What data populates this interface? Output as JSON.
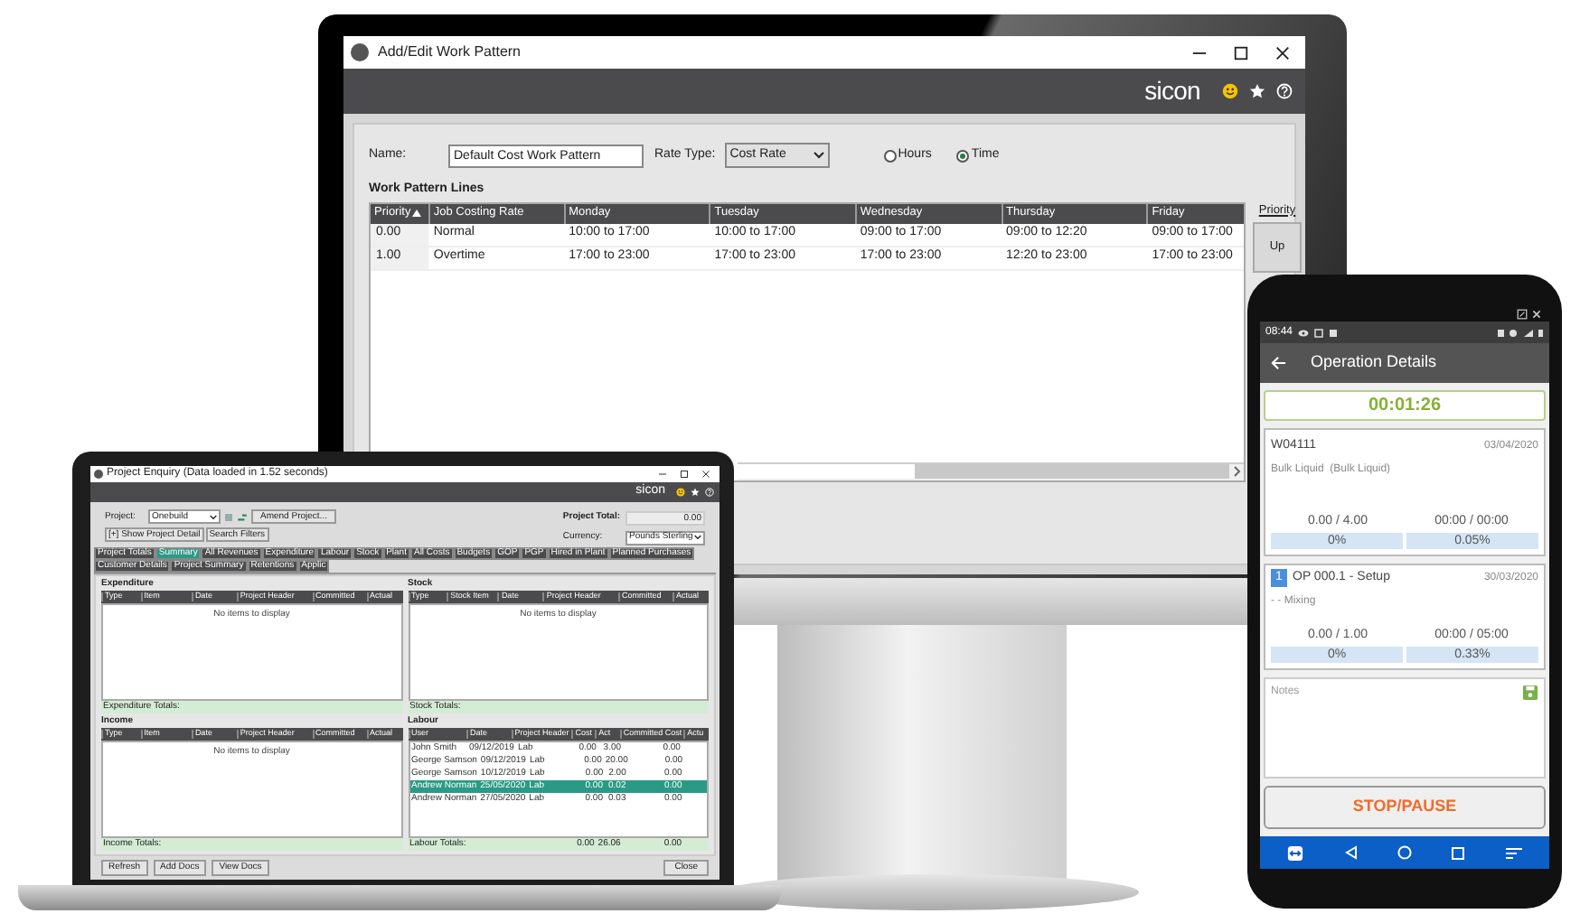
{
  "monitor": {
    "window_title": "Add/Edit Work Pattern",
    "brand": "sicon",
    "name_label": "Name:",
    "name_value": "Default Cost Work Pattern",
    "rate_type_label": "Rate Type:",
    "rate_type_value": "Cost Rate",
    "radios": [
      {
        "label": "Hours",
        "selected": false
      },
      {
        "label": "Time",
        "selected": true
      }
    ],
    "section_title": "Work Pattern Lines",
    "columns": [
      "Priority",
      "Job Costing Rate",
      "Monday",
      "Tuesday",
      "Wednesday",
      "Thursday",
      "Friday"
    ],
    "rows": [
      [
        "0.00",
        "Normal",
        "10:00 to 17:00",
        "10:00 to 17:00",
        "09:00 to 17:00",
        "09:00 to 12:20",
        "09:00 to 17:00"
      ],
      [
        "1.00",
        "Overtime",
        "17:00 to 23:00",
        "17:00 to 23:00",
        "17:00 to 23:00",
        "12:20 to 23:00",
        "17:00 to 23:00"
      ]
    ],
    "priority_label": "Priority",
    "up_button": "Up"
  },
  "laptop": {
    "window_title": "Project Enquiry (Data loaded in 1.52 seconds)",
    "brand": "sicon",
    "project_label": "Project:",
    "project_value": "Onebuild",
    "amend_button": "Amend Project...",
    "show_detail_button": "[+] Show Project Detail",
    "search_filters_button": "Search Filters",
    "project_total_label": "Project Total:",
    "project_total_value": "0.00",
    "currency_label": "Currency:",
    "currency_value": "Pounds Sterling",
    "tabs": [
      {
        "label": "Project Totals",
        "selected": false
      },
      {
        "label": "Summary",
        "selected": true
      },
      {
        "label": "All Revenues",
        "selected": false
      },
      {
        "label": "Expenditure",
        "selected": false
      },
      {
        "label": "Labour",
        "selected": false
      },
      {
        "label": "Stock",
        "selected": false
      },
      {
        "label": "Plant",
        "selected": false
      },
      {
        "label": "All Costs",
        "selected": false
      },
      {
        "label": "Budgets",
        "selected": false
      },
      {
        "label": "GOP",
        "selected": false
      },
      {
        "label": "PGP",
        "selected": false
      },
      {
        "label": "Hired in Plant",
        "selected": false
      },
      {
        "label": "Planned Purchases",
        "selected": false
      },
      {
        "label": "Customer Details",
        "selected": false
      },
      {
        "label": "Project Summary",
        "selected": false
      },
      {
        "label": "Retentions",
        "selected": false
      },
      {
        "label": "Applic",
        "selected": false
      }
    ],
    "panels": [
      {
        "title": "Expenditure",
        "columns": [
          "Type",
          "Item",
          "Date",
          "Project Header",
          "Committed",
          "Actual"
        ],
        "empty_text": "No items to display",
        "totals": [
          "Expenditure Totals:"
        ]
      },
      {
        "title": "Stock",
        "columns": [
          "Type",
          "Stock Item",
          "Date",
          "Project Header",
          "Committed",
          "Actual"
        ],
        "empty_text": "No items to display",
        "totals": [
          "Stock Totals:"
        ]
      },
      {
        "title": "Income",
        "columns": [
          "Type",
          "Item",
          "Date",
          "Project Header",
          "Committed",
          "Actual"
        ],
        "empty_text": "No items to display",
        "totals": [
          "Income Totals:"
        ]
      },
      {
        "title": "Labour",
        "columns": [
          "User",
          "Date",
          "Project Header",
          "Cost",
          "Act",
          "Committed Cost",
          "Actu"
        ],
        "rows": [
          {
            "cells": [
              "John Smith",
              "09/12/2019",
              "Lab",
              "0.00",
              "3.00",
              "0.00"
            ],
            "selected": false
          },
          {
            "cells": [
              "George Samson",
              "09/12/2019",
              "Lab",
              "0.00",
              "20.00",
              "0.00"
            ],
            "selected": false
          },
          {
            "cells": [
              "George Samson",
              "10/12/2019",
              "Lab",
              "0.00",
              "2.00",
              "0.00"
            ],
            "selected": false
          },
          {
            "cells": [
              "Andrew Norman",
              "25/05/2020",
              "Lab",
              "0.00",
              "0.02",
              "0.00"
            ],
            "selected": true
          },
          {
            "cells": [
              "Andrew Norman",
              "27/05/2020",
              "Lab",
              "0.00",
              "0.03",
              "0.00"
            ],
            "selected": false
          }
        ],
        "totals": [
          "Labour Totals:",
          "0.00",
          "26.06",
          "0.00"
        ]
      }
    ],
    "buttons": [
      "Refresh",
      "Add Docs",
      "View Docs"
    ],
    "close_button": "Close"
  },
  "phone": {
    "time": "08:44",
    "title": "Operation Details",
    "timer": "00:01:26",
    "cards": [
      {
        "code": "W04111",
        "date": "03/04/2020",
        "description": "Bulk Liquid  (Bulk Liquid)",
        "quantities": [
          "0.00 / 4.00",
          "00:00 / 00:00"
        ],
        "percents": [
          "0%",
          "0.05%"
        ]
      },
      {
        "badge": "1",
        "code": "OP 000.1 - Setup",
        "date": "30/03/2020",
        "description": "- - Mixing",
        "quantities": [
          "0.00 / 1.00",
          "00:00 / 05:00"
        ],
        "percents": [
          "0%",
          "0.33%"
        ]
      }
    ],
    "notes_placeholder": "Notes",
    "button": "STOP/PAUSE"
  }
}
